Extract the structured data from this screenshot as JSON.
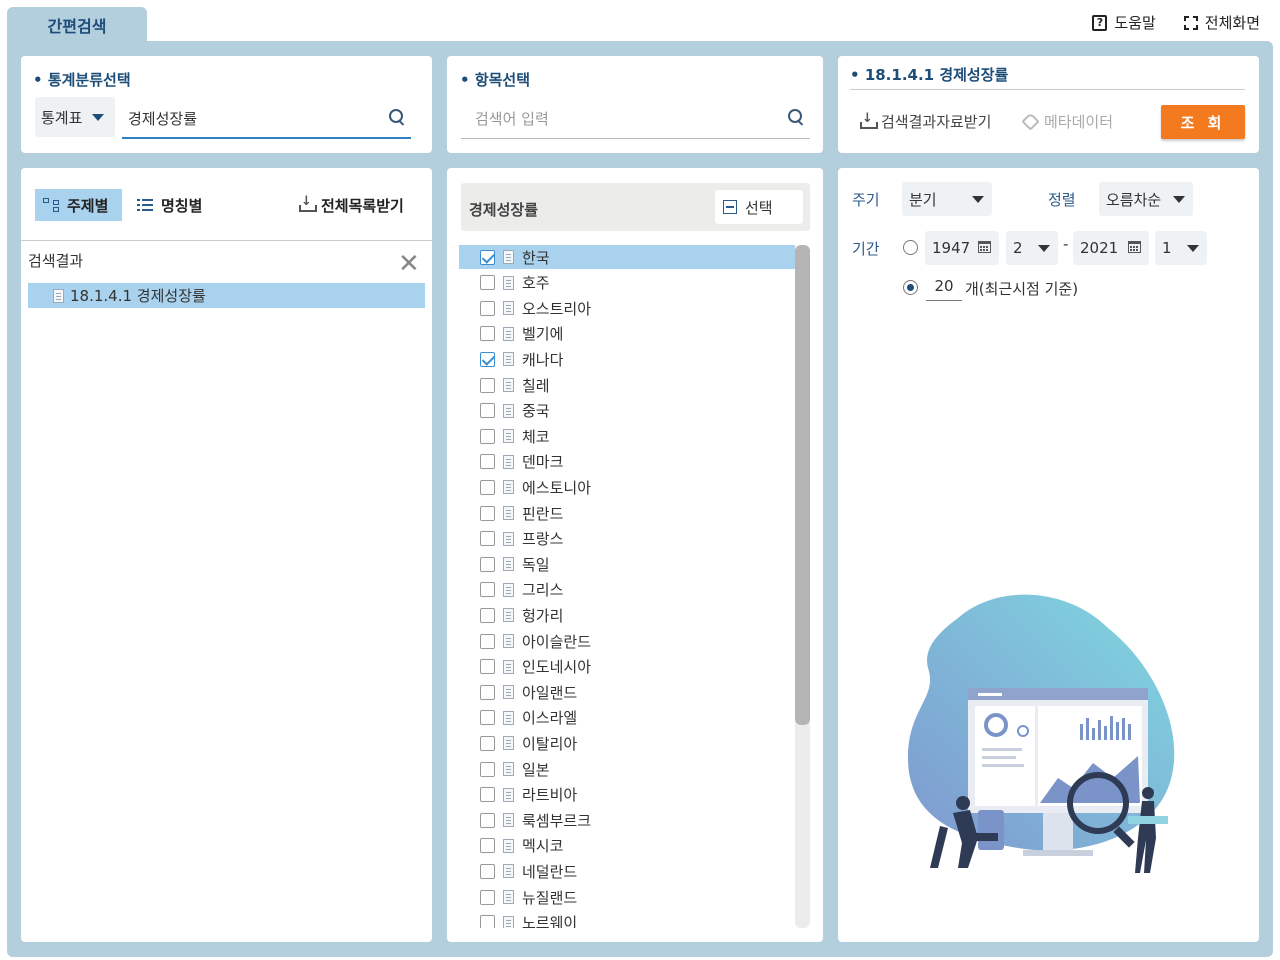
{
  "header": {
    "tab_title": "간편검색",
    "help_label": "도움말",
    "fullscreen_label": "전체화면"
  },
  "stat_select": {
    "title": "통계분류선택",
    "category_value": "통계표",
    "search_value": "경제성장률"
  },
  "item_select": {
    "title": "항목선택",
    "search_placeholder": "검색어 입력"
  },
  "result_header": {
    "title": "18.1.4.1 경제성장률",
    "download_label": "검색결과자료받기",
    "metadata_label": "메타데이터",
    "query_label": "조 회"
  },
  "tree_panel": {
    "tab_subject": "주제별",
    "tab_name": "명칭별",
    "download_all": "전체목록받기",
    "result_label": "검색결과",
    "result_item": "18.1.4.1 경제성장률"
  },
  "item_panel": {
    "header_title": "경제성장률",
    "select_label": "선택",
    "items": [
      {
        "label": "한국",
        "checked": true,
        "selected": true
      },
      {
        "label": "호주",
        "checked": false
      },
      {
        "label": "오스트리아",
        "checked": false
      },
      {
        "label": "벨기에",
        "checked": false
      },
      {
        "label": "캐나다",
        "checked": true
      },
      {
        "label": "칠레",
        "checked": false
      },
      {
        "label": "중국",
        "checked": false
      },
      {
        "label": "체코",
        "checked": false
      },
      {
        "label": "덴마크",
        "checked": false
      },
      {
        "label": "에스토니아",
        "checked": false
      },
      {
        "label": "핀란드",
        "checked": false
      },
      {
        "label": "프랑스",
        "checked": false
      },
      {
        "label": "독일",
        "checked": false
      },
      {
        "label": "그리스",
        "checked": false
      },
      {
        "label": "헝가리",
        "checked": false
      },
      {
        "label": "아이슬란드",
        "checked": false
      },
      {
        "label": "인도네시아",
        "checked": false
      },
      {
        "label": "아일랜드",
        "checked": false
      },
      {
        "label": "이스라엘",
        "checked": false
      },
      {
        "label": "이탈리아",
        "checked": false
      },
      {
        "label": "일본",
        "checked": false
      },
      {
        "label": "라트비아",
        "checked": false
      },
      {
        "label": "룩셈부르크",
        "checked": false
      },
      {
        "label": "멕시코",
        "checked": false
      },
      {
        "label": "네덜란드",
        "checked": false
      },
      {
        "label": "뉴질랜드",
        "checked": false
      },
      {
        "label": "노르웨이",
        "checked": false
      }
    ]
  },
  "options": {
    "cycle_label": "주기",
    "cycle_value": "분기",
    "sort_label": "정렬",
    "sort_value": "오름차순",
    "period_label": "기간",
    "start_year": "1947",
    "start_quarter": "2",
    "end_year": "2021",
    "end_quarter": "1",
    "range_separator": "-",
    "recent_count": "20",
    "recent_label": "개(최근시점 기준)",
    "period_mode": "recent"
  }
}
